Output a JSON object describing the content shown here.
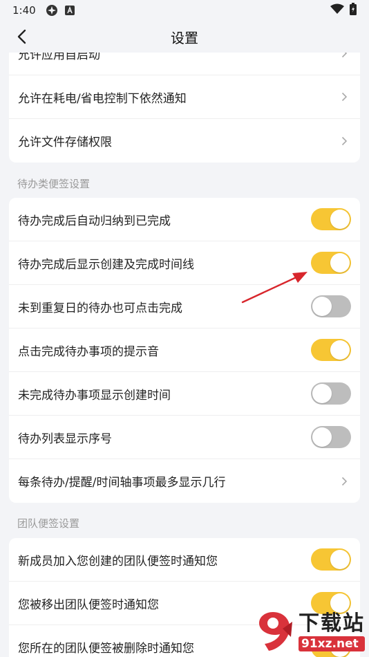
{
  "status_bar": {
    "time": "1:40"
  },
  "header": {
    "title": "设置"
  },
  "permissions": {
    "items": [
      {
        "label": "允许应用自启动"
      },
      {
        "label": "允许在耗电/省电控制下依然通知"
      },
      {
        "label": "允许文件存储权限"
      }
    ]
  },
  "todo_section": {
    "title": "待办类便签设置",
    "items": [
      {
        "label": "待办完成后自动归纳到已完成",
        "state": "on"
      },
      {
        "label": "待办完成后显示创建及完成时间线",
        "state": "on"
      },
      {
        "label": "未到重复日的待办也可点击完成",
        "state": "off"
      },
      {
        "label": "点击完成待办事项的提示音",
        "state": "on"
      },
      {
        "label": "未完成待办事项显示创建时间",
        "state": "off"
      },
      {
        "label": "待办列表显示序号",
        "state": "off"
      },
      {
        "label": "每条待办/提醒/时间轴事项最多显示几行",
        "state": "chevron"
      }
    ]
  },
  "team_section": {
    "title": "团队便签设置",
    "items": [
      {
        "label": "新成员加入您创建的团队便签时通知您",
        "state": "on"
      },
      {
        "label": "您被移出团队便签时通知您",
        "state": "on"
      },
      {
        "label": "您所在的团队便签被删除时通知您",
        "state": "on"
      }
    ]
  },
  "watermark": {
    "brand_cn": "下载站",
    "brand_en": "91xz.net"
  },
  "colors": {
    "toggle_on": "#f7c634",
    "toggle_off": "#bdbdbd",
    "annotation_arrow": "#d8262c"
  }
}
